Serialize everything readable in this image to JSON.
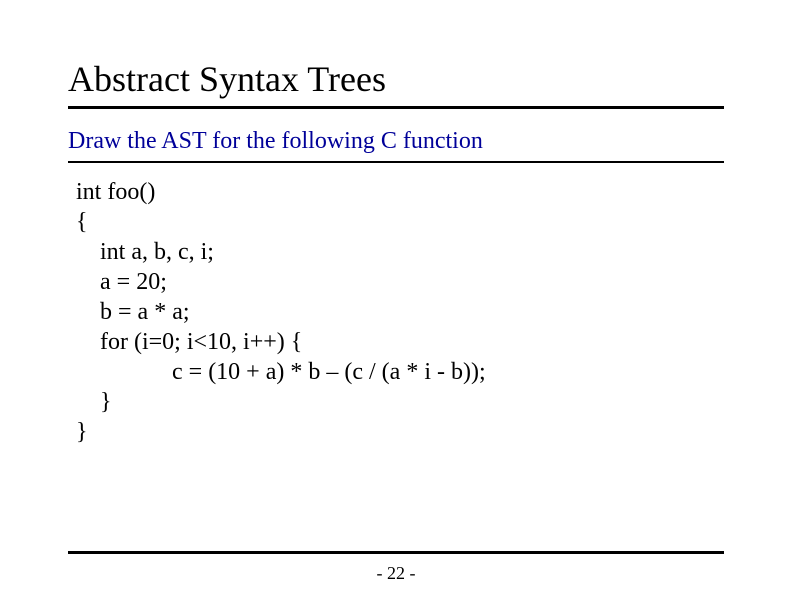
{
  "title": "Abstract Syntax Trees",
  "subtitle": "Draw the AST for the following C function",
  "code": {
    "l1": "int foo()",
    "l2": "{",
    "l3": "    int a, b, c, i;",
    "l4": "    a = 20;",
    "l5": "    b = a * a;",
    "l6": "    for (i=0; i<10, i++) {",
    "l7": "                c = (10 + a) * b – (c / (a * i - b));",
    "l8": "    }",
    "l9": "}"
  },
  "page_number": "- 22 -"
}
